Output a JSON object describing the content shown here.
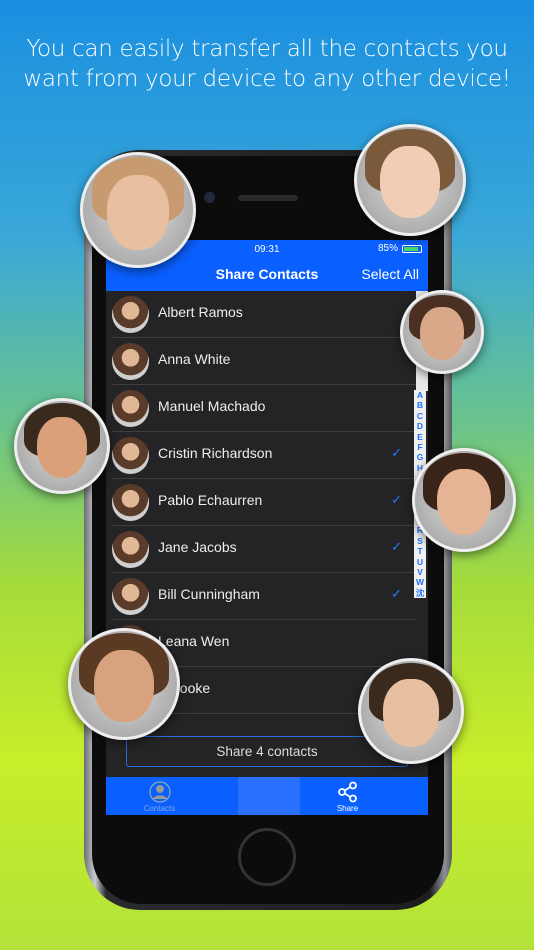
{
  "headline": {
    "line1": "You can easily transfer all the contacts you",
    "line2": "want from your device to any other device!"
  },
  "status": {
    "time": "09:31",
    "battery": "85%",
    "battery_level": 0.85
  },
  "nav": {
    "title": "Share Contacts",
    "select_all": "Select All"
  },
  "contacts": [
    {
      "name": "Albert Ramos",
      "checked": false
    },
    {
      "name": "Anna White",
      "checked": false
    },
    {
      "name": "Manuel Machado",
      "checked": false
    },
    {
      "name": "Cristin Richardson",
      "checked": true
    },
    {
      "name": "Pablo Echaurren",
      "checked": true
    },
    {
      "name": "Jane Jacobs",
      "checked": true
    },
    {
      "name": "Bill Cunningham",
      "checked": true
    },
    {
      "name": "Leana Wen",
      "checked": false
    },
    {
      "name": "n Cooke",
      "checked": false
    }
  ],
  "check_glyph": "✓",
  "index": [
    "A",
    "B",
    "C",
    "D",
    "E",
    "F",
    "G",
    "H",
    "I",
    "J",
    "K",
    "L",
    "P",
    "R",
    "S",
    "T",
    "U",
    "V",
    "W",
    "沈"
  ],
  "share_button": "Share 4 contacts",
  "tabs": [
    {
      "label": "Contacts",
      "icon": "person-icon",
      "active": false
    },
    {
      "label": "",
      "icon": "",
      "active": false
    },
    {
      "label": "Share",
      "icon": "share-icon",
      "active": true
    }
  ],
  "colors": {
    "accent": "#0a5fff",
    "check": "#1e7fff",
    "list_bg": "#242426"
  }
}
